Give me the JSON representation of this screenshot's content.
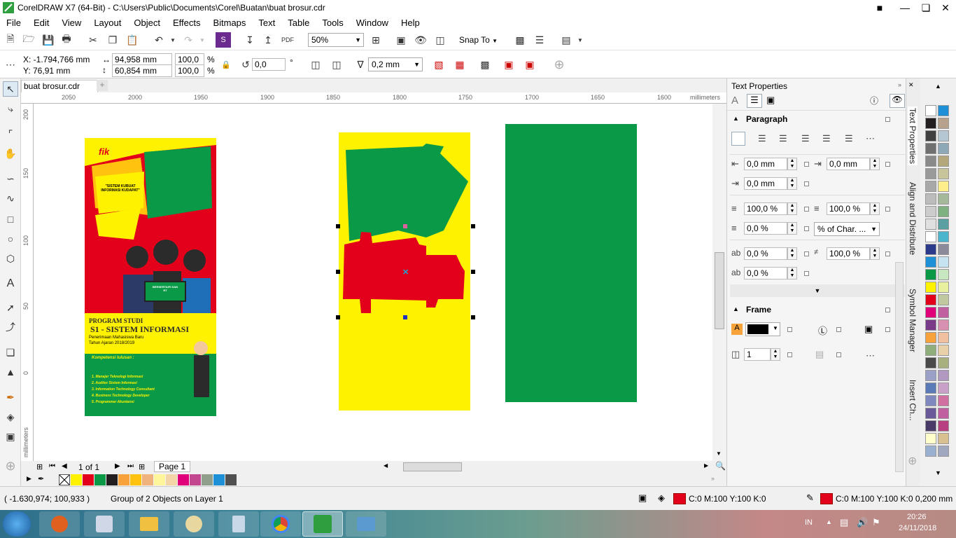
{
  "window": {
    "title": "CorelDRAW X7 (64-Bit) - C:\\Users\\Public\\Documents\\Corel\\Buatan\\buat brosur.cdr"
  },
  "menu": [
    "File",
    "Edit",
    "View",
    "Layout",
    "Object",
    "Effects",
    "Bitmaps",
    "Text",
    "Table",
    "Tools",
    "Window",
    "Help"
  ],
  "toolbar": {
    "zoom": "50%",
    "snap_to": "Snap To"
  },
  "propbar": {
    "x": "X: -1.794,766 mm",
    "y": "Y: 76,91 mm",
    "w": "94,958 mm",
    "h": "60,854 mm",
    "sx": "100,0",
    "sy": "100,0",
    "pct": "%",
    "rotate": "0,0",
    "deg": "°",
    "outline": "0,2 mm"
  },
  "doc": {
    "tab": "buat brosur.cdr"
  },
  "ruler_h": [
    "2050",
    "2000",
    "1950",
    "1900",
    "1850",
    "1800",
    "1750",
    "1700",
    "1650",
    "1600",
    "millimeters"
  ],
  "ruler_v": [
    "200",
    "150",
    "100",
    "50",
    "0",
    "millimeters"
  ],
  "brochure": {
    "logo": "fik",
    "bubble": "\"SISTEM KUBUAT INFORMASI KUDAPAT\"",
    "screen": "BERSERTAIFI DAN RT",
    "program": "PROGRAM STUDI",
    "major": "S1 - SISTEM INFORMASI",
    "sub1": "Penerimaan Mahasiswa Baru",
    "sub2": "Tahun Ajaran 2018/2019",
    "kompetensi": "Kompetensi lulusan :",
    "list": [
      "1. Manajer Teknologi Informasi",
      "2. Auditor Sistem Informasi",
      "3. Information Technology Consultant",
      "4. Business Technology Developer",
      "5. Programmer Akuntansi"
    ]
  },
  "pagenav": {
    "count": "1 of 1",
    "page": "Page 1"
  },
  "colors": {
    "green": "#0a9a47",
    "yellow": "#fff200",
    "red": "#e3001b"
  },
  "docker": {
    "title": "Text Properties",
    "paragraph": "Paragraph",
    "indent1": "0,0 mm",
    "indent2": "0,0 mm",
    "indent3": "0,0 mm",
    "sp1": "100,0 %",
    "sp2": "100,0 %",
    "sp3": "0,0 %",
    "sp_unit": "% of Char. ...",
    "sp4": "0,0 %",
    "sp5": "100,0 %",
    "sp6": "0,0 %",
    "frame": "Frame",
    "cols": "1"
  },
  "dtabs": [
    "Text Properties",
    "Align and Distribute",
    "Symbol Manager",
    "Insert Ch..."
  ],
  "status": {
    "coords": "( -1.630,974; 100,933 )",
    "info": "Group of 2 Objects on Layer 1",
    "fill": "C:0 M:100 Y:100 K:0",
    "outline": "C:0 M:100 Y:100 K:0  0,200 mm"
  },
  "tray": {
    "lang": "IN",
    "time": "20:26",
    "date": "24/11/2018"
  }
}
